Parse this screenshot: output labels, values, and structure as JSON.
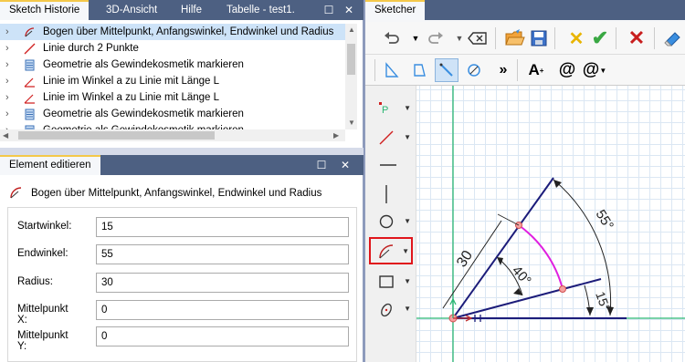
{
  "left_tabs": [
    {
      "label": "Sketch Historie",
      "active": true
    },
    {
      "label": "3D-Ansicht",
      "active": false
    },
    {
      "label": "Hilfe",
      "active": false
    },
    {
      "label": "Tabelle - test1.",
      "active": false
    }
  ],
  "tree_items": [
    {
      "label": "Bogen über Mittelpunkt, Anfangswinkel, Endwinkel und Radius",
      "icon": "arc-icon",
      "selected": true
    },
    {
      "label": "Linie durch 2 Punkte",
      "icon": "line-icon",
      "selected": false
    },
    {
      "label": "Geometrie als Gewindekosmetik markieren",
      "icon": "thread-cosmetic-icon",
      "selected": false
    },
    {
      "label": "Linie im Winkel a zu Linie mit Länge L",
      "icon": "angle-line-icon",
      "selected": false
    },
    {
      "label": "Linie im Winkel a zu Linie mit Länge L",
      "icon": "angle-line-icon",
      "selected": false
    },
    {
      "label": "Geometrie als Gewindekosmetik markieren",
      "icon": "thread-cosmetic-icon",
      "selected": false
    },
    {
      "label": "Geometrie als Gewindekosmetik markieren",
      "icon": "thread-cosmetic-icon",
      "selected": false
    }
  ],
  "edit_panel": {
    "tab_label": "Element editieren",
    "title": "Bogen über Mittelpunkt, Anfangswinkel, Endwinkel und Radius",
    "fields": [
      {
        "label": "Startwinkel:",
        "value": "15"
      },
      {
        "label": "Endwinkel:",
        "value": "55"
      },
      {
        "label": "Radius:",
        "value": "30"
      },
      {
        "label": "Mittelpunkt X:",
        "value": "0"
      },
      {
        "label": "Mittelpunkt Y:",
        "value": "0"
      }
    ]
  },
  "sketcher": {
    "tab_label": "Sketcher",
    "more_label": "»",
    "text_tool_label": "A",
    "at_label": "@",
    "dim_labels": {
      "radius": "30",
      "arc_angle": "40°",
      "outer_angle": "55°",
      "start_angle": "15°"
    }
  },
  "colors": {
    "tab_bar": "#4d6082",
    "selection": "#cde3f8",
    "arc": "#e020e0",
    "geometry": "#1c1c7a",
    "axis": "#2bb673",
    "highlight_box": "#e0151b"
  }
}
